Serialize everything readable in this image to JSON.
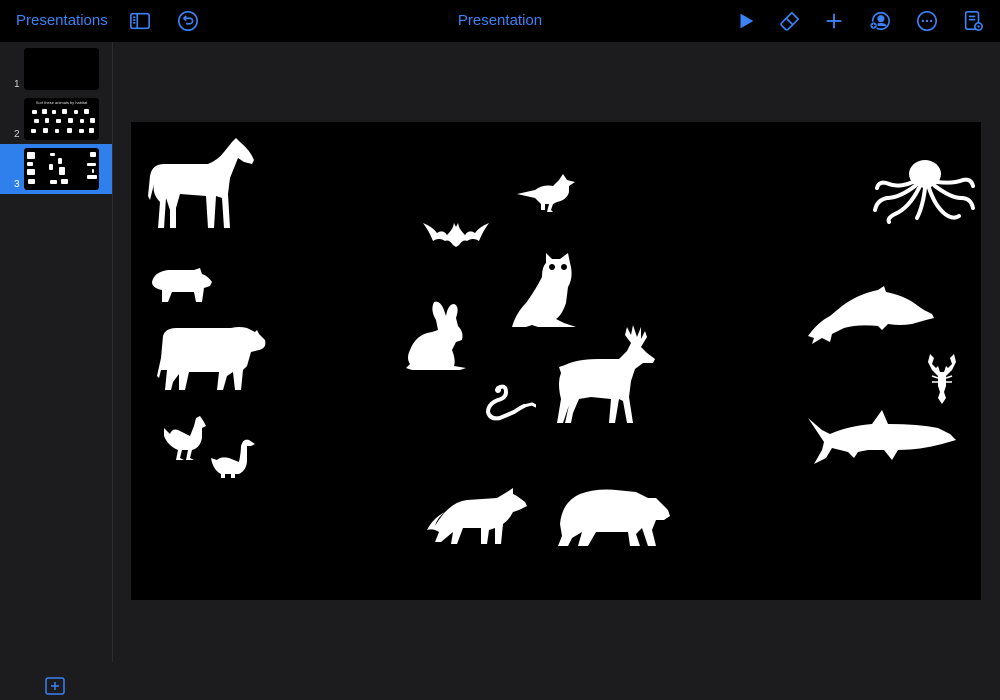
{
  "app": {
    "back_label": "Presentations",
    "title": "Presentation"
  },
  "toolbar": {
    "icons": [
      "sidebar-toggle-icon",
      "undo-icon",
      "play-icon",
      "format-brush-icon",
      "add-icon",
      "collaborate-icon",
      "more-icon",
      "document-options-icon"
    ],
    "accent_color": "#3b82f6"
  },
  "slides": [
    {
      "number": "1"
    },
    {
      "number": "2",
      "caption": "Sort these animals by habitat"
    },
    {
      "number": "3",
      "selected": true
    }
  ],
  "slide_canvas": {
    "background": "#000000",
    "animals": [
      "horse",
      "pig",
      "cow",
      "chicken",
      "goose",
      "bat",
      "bird",
      "owl",
      "rabbit",
      "snake",
      "deer",
      "wolf",
      "bear",
      "octopus",
      "dolphin",
      "lobster",
      "shark"
    ]
  },
  "colors": {
    "selected_slide": "#2f80ed",
    "sidebar": "#1c1c1e",
    "topbar": "#000000"
  }
}
